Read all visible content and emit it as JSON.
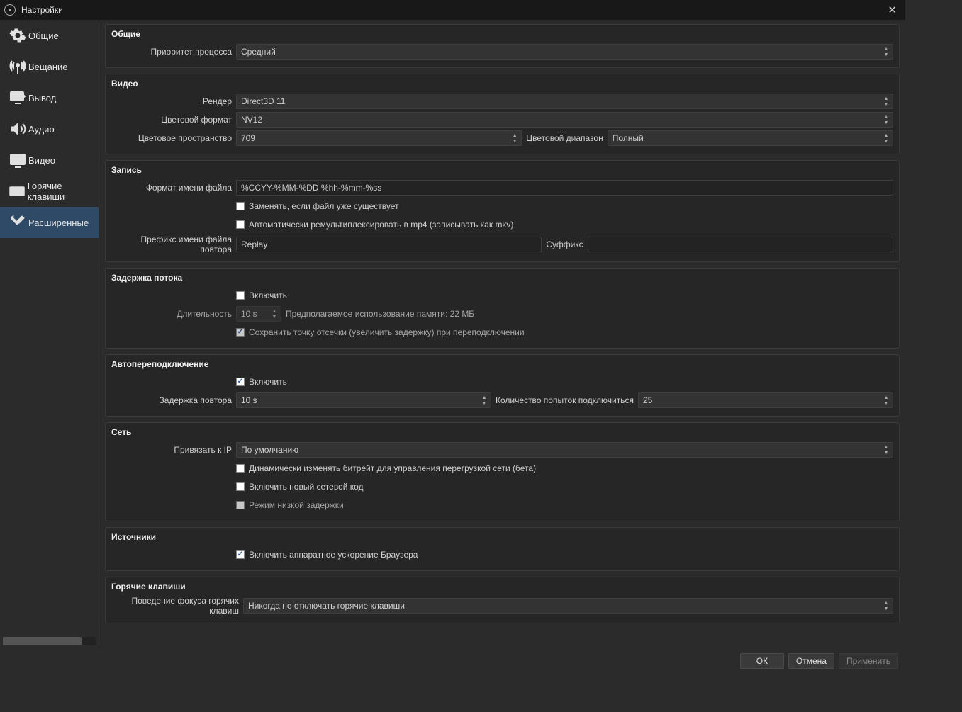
{
  "titlebar": {
    "title": "Настройки"
  },
  "sidebar": {
    "items": [
      {
        "label": "Общие"
      },
      {
        "label": "Вещание"
      },
      {
        "label": "Вывод"
      },
      {
        "label": "Аудио"
      },
      {
        "label": "Видео"
      },
      {
        "label": "Горячие клавиши"
      },
      {
        "label": "Расширенные"
      }
    ]
  },
  "groups": {
    "general": {
      "title": "Общие",
      "priority_label": "Приоритет процесса",
      "priority_value": "Средний"
    },
    "video": {
      "title": "Видео",
      "renderer_label": "Рендер",
      "renderer_value": "Direct3D 11",
      "color_format_label": "Цветовой формат",
      "color_format_value": "NV12",
      "color_space_label": "Цветовое пространство",
      "color_space_value": "709",
      "color_range_label": "Цветовой диапазон",
      "color_range_value": "Полный"
    },
    "recording": {
      "title": "Запись",
      "filename_format_label": "Формат имени файла",
      "filename_format_value": "%CCYY-%MM-%DD %hh-%mm-%ss",
      "overwrite_label": "Заменять, если файл уже существует",
      "remux_label": "Автоматически ремультиплексировать в mp4 (записывать как mkv)",
      "replay_prefix_label": "Префикс имени файла повтора",
      "replay_prefix_value": "Replay",
      "replay_suffix_label": "Суффикс",
      "replay_suffix_value": ""
    },
    "stream_delay": {
      "title": "Задержка потока",
      "enable_label": "Включить",
      "duration_label": "Длительность",
      "duration_value": "10 s",
      "memory_label": "Предполагаемое использование памяти: 22 МБ",
      "preserve_label": "Сохранить точку отсечки (увеличить задержку) при переподключении"
    },
    "reconnect": {
      "title": "Автопереподключение",
      "enable_label": "Включить",
      "retry_delay_label": "Задержка повтора",
      "retry_delay_value": "10 s",
      "max_retries_label": "Количество попыток подключиться",
      "max_retries_value": "25"
    },
    "network": {
      "title": "Сеть",
      "bind_ip_label": "Привязать к IP",
      "bind_ip_value": "По умолчанию",
      "dyn_bitrate_label": "Динамически изменять битрейт для управления перегрузкой сети (бета)",
      "new_code_label": "Включить новый сетевой код",
      "low_latency_label": "Режим низкой задержки"
    },
    "sources": {
      "title": "Источники",
      "browser_hw_label": "Включить аппаратное ускорение Браузера"
    },
    "hotkeys": {
      "title": "Горячие клавиши",
      "focus_behavior_label": "Поведение фокуса горячих клавиш",
      "focus_behavior_value": "Никогда не отключать горячие клавиши"
    }
  },
  "footer": {
    "ok": "ОК",
    "cancel": "Отмена",
    "apply": "Применить"
  }
}
